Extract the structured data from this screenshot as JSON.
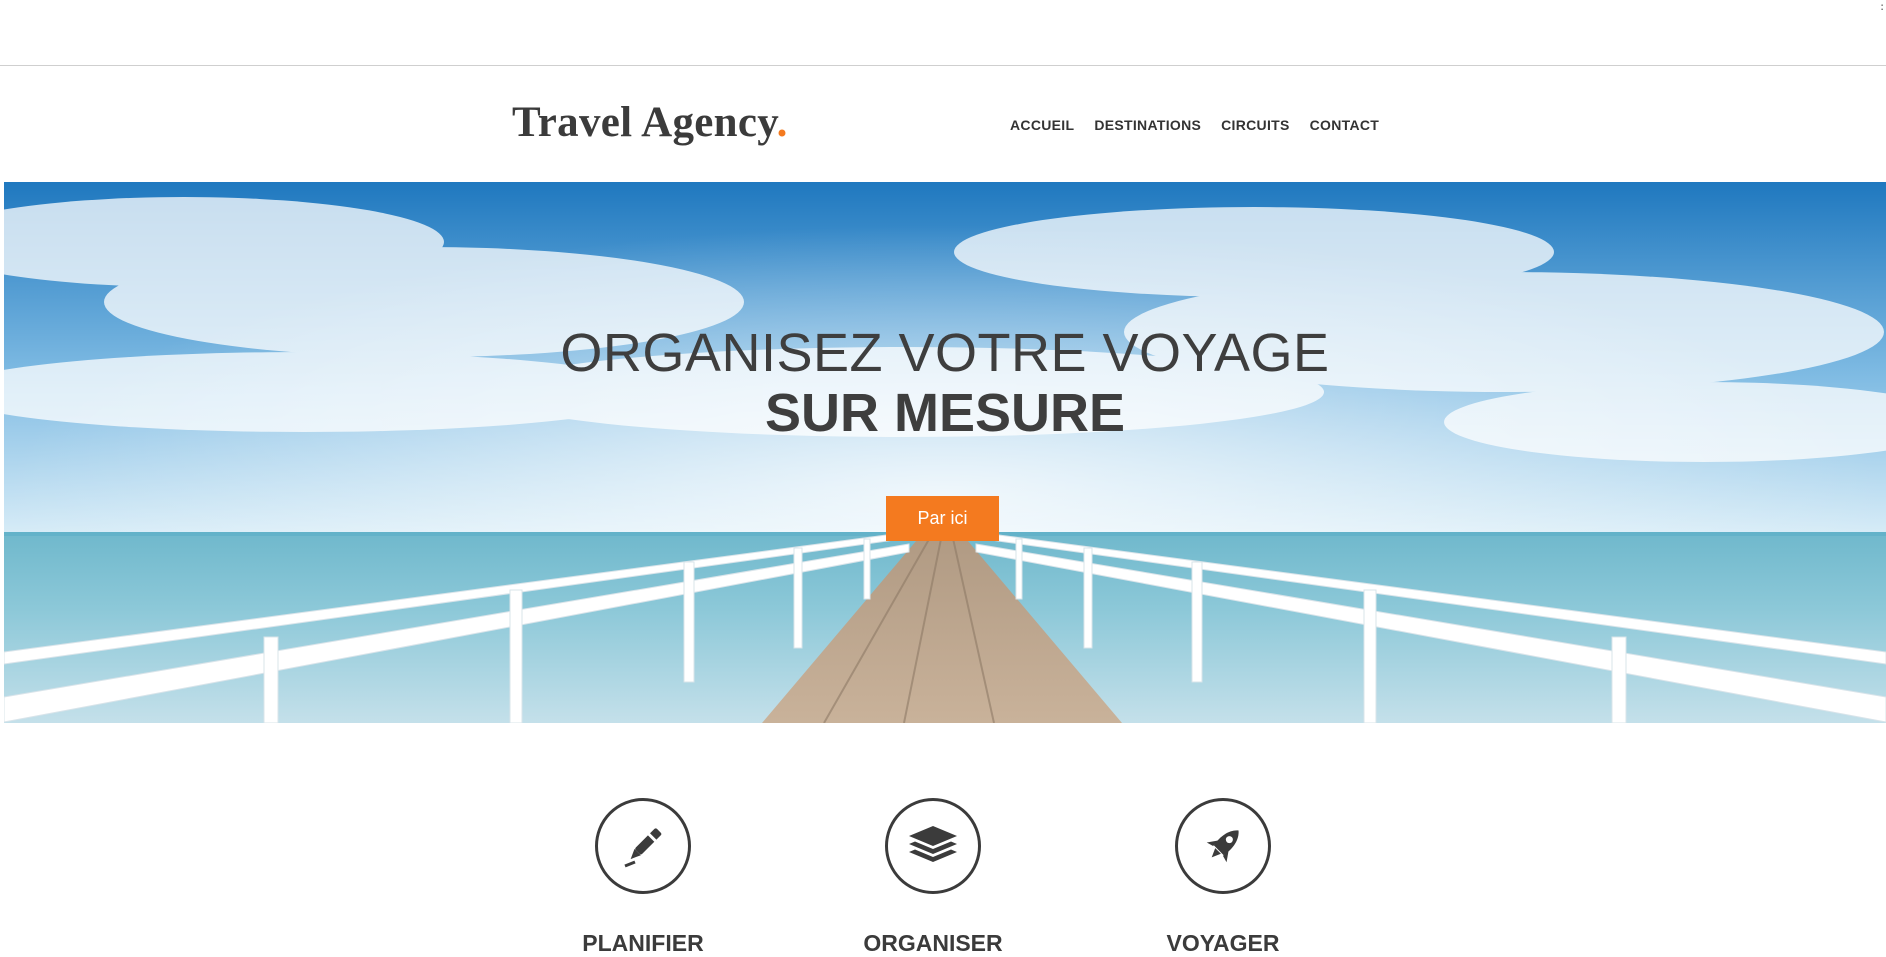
{
  "brand": {
    "name": "Travel Agency",
    "dot": ".",
    "accent_color": "#f47a1f"
  },
  "nav": {
    "items": [
      {
        "label": "ACCUEIL"
      },
      {
        "label": "DESTINATIONS"
      },
      {
        "label": "CIRCUITS"
      },
      {
        "label": "CONTACT"
      }
    ]
  },
  "hero": {
    "line1": "ORGANISEZ VOTRE VOYAGE",
    "line2": "SUR MESURE",
    "cta_label": "Par ici",
    "background": "pier-over-sea-photo"
  },
  "features": [
    {
      "icon": "pen-icon",
      "label": "PLANIFIER"
    },
    {
      "icon": "layers-icon",
      "label": "ORGANISER"
    },
    {
      "icon": "rocket-icon",
      "label": "VOYAGER"
    }
  ]
}
